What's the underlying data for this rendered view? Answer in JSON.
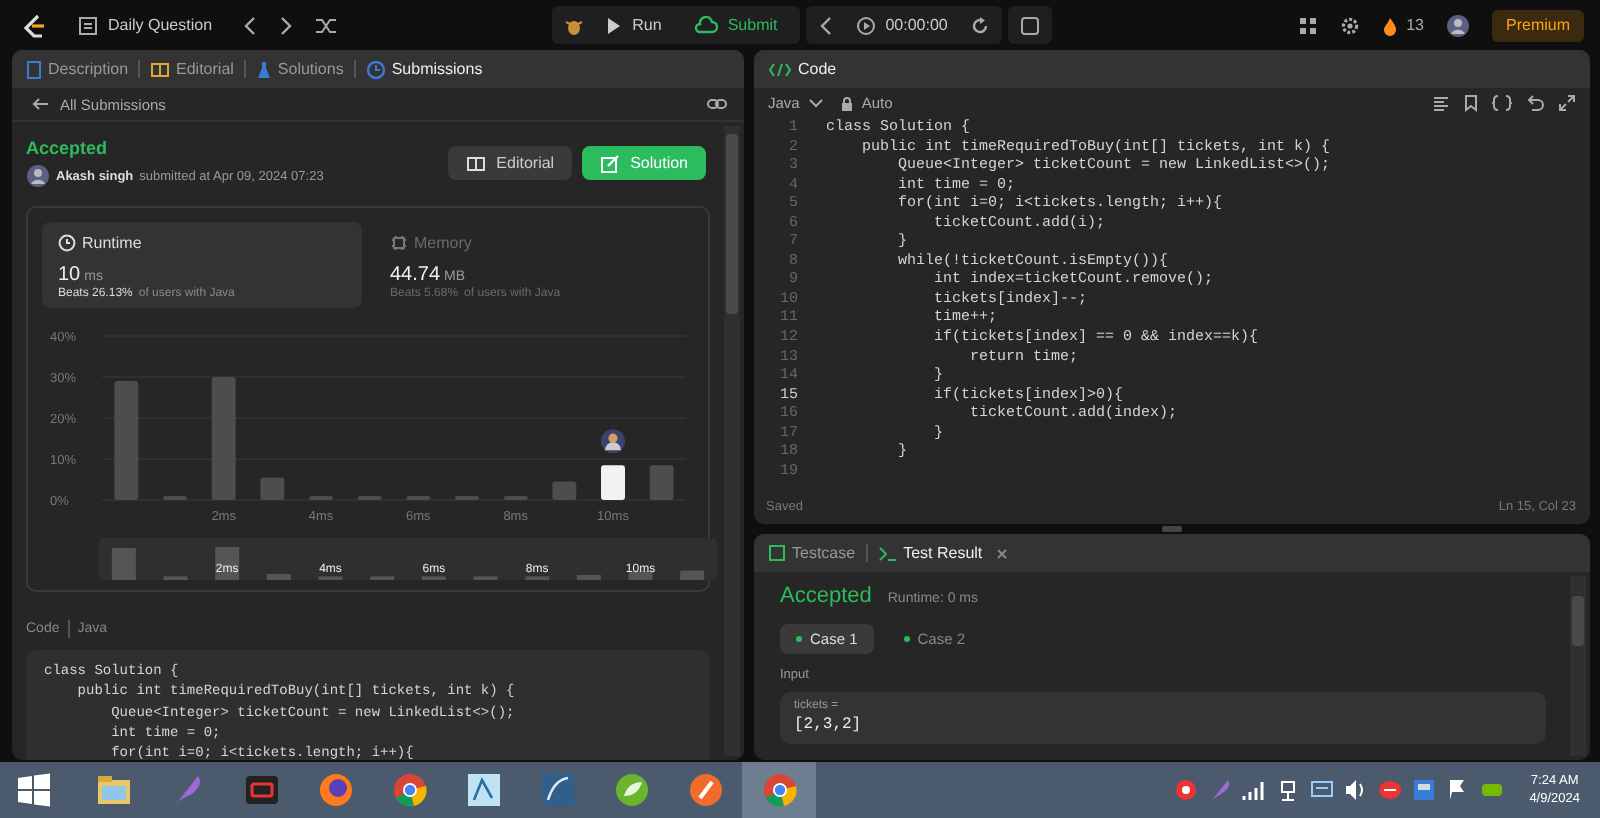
{
  "top_bar": {
    "title": "Daily Question",
    "run": "Run",
    "submit": "Submit",
    "timer": "00:00:00",
    "streak": "13",
    "premium": "Premium"
  },
  "problem_tabs": [
    {
      "label": "Description",
      "kind": "description",
      "selected": false
    },
    {
      "label": "Editorial",
      "kind": "editorial",
      "selected": false
    },
    {
      "label": "Solutions",
      "kind": "solutions",
      "selected": false
    },
    {
      "label": "Submissions",
      "kind": "submissions",
      "selected": true
    }
  ],
  "back_link": "All Submissions",
  "submission": {
    "status": "Accepted",
    "user": "Akash singh",
    "submitted": "submitted at Apr 09, 2024 07:23",
    "buttons": [
      {
        "label": "Editorial",
        "kind": "editorial"
      },
      {
        "label": "Solution",
        "kind": "solution"
      }
    ]
  },
  "stats": [
    {
      "title": "Runtime",
      "kind": "runtime",
      "value": "10",
      "unit": "ms",
      "beats": "Beats 26.13%",
      "suffix": "of users with Java",
      "selected": true
    },
    {
      "title": "Memory",
      "kind": "memory",
      "value": "44.74",
      "unit": "MB",
      "beats": "Beats 5.68%",
      "suffix": "of users with Java",
      "selected": false
    }
  ],
  "chart_data": {
    "type": "bar",
    "x": [
      0,
      1,
      2,
      3,
      4,
      5,
      6,
      7,
      8,
      9,
      10,
      11
    ],
    "xlim": [
      -0.5,
      11.5
    ],
    "grid": true,
    "stacked": true,
    "series": [
      {
        "color": "#4d4d4d",
        "values": [
          29,
          1,
          30,
          5.5,
          1,
          1,
          1,
          1,
          1,
          4.5,
          null,
          8.5
        ]
      },
      {
        "color": "#f2f2f2",
        "values": [
          null,
          null,
          null,
          null,
          null,
          null,
          null,
          null,
          null,
          null,
          8.5,
          null
        ]
      }
    ],
    "ylim": [
      0,
      40
    ],
    "yticks": [
      {
        "value": 0,
        "label": "0%"
      },
      {
        "value": 10,
        "label": "10%"
      },
      {
        "value": 20,
        "label": "20%"
      },
      {
        "value": 30,
        "label": "30%"
      },
      {
        "value": 40,
        "label": "40%"
      }
    ],
    "xticks": [
      {
        "value": 2,
        "label": "2ms"
      },
      {
        "value": 4,
        "label": "4ms"
      },
      {
        "value": 6,
        "label": "6ms"
      },
      {
        "value": 8,
        "label": "8ms"
      },
      {
        "value": 10,
        "label": "10ms"
      }
    ]
  },
  "overview_labels": [
    "2ms",
    "4ms",
    "6ms",
    "8ms",
    "10ms"
  ],
  "code_section": {
    "label": "Code",
    "language": "Java",
    "lines": [
      "class Solution {",
      "    public int timeRequiredToBuy(int[] tickets, int k) {",
      "        Queue<Integer> ticketCount = new LinkedList<>();",
      "        int time = 0;",
      "        for(int i=0; i<tickets.length; i++){"
    ]
  },
  "editor": {
    "tab": "Code",
    "language": "Java",
    "mode": "Auto",
    "status": "Saved",
    "cursor": "Ln 15, Col 23",
    "lines": [
      {
        "number": "1",
        "code": "class Solution {",
        "selected": false
      },
      {
        "number": "2",
        "code": "    public int timeRequiredToBuy(int[] tickets, int k) {",
        "selected": false
      },
      {
        "number": "3",
        "code": "        Queue<Integer> ticketCount = new LinkedList<>();",
        "selected": false
      },
      {
        "number": "4",
        "code": "        int time = 0;",
        "selected": false
      },
      {
        "number": "5",
        "code": "        for(int i=0; i<tickets.length; i++){",
        "selected": false
      },
      {
        "number": "6",
        "code": "            ticketCount.add(i);",
        "selected": false
      },
      {
        "number": "7",
        "code": "        }",
        "selected": false
      },
      {
        "number": "8",
        "code": "        while(!ticketCount.isEmpty()){",
        "selected": false
      },
      {
        "number": "9",
        "code": "            int index=ticketCount.remove();",
        "selected": false
      },
      {
        "number": "10",
        "code": "            tickets[index]--;",
        "selected": false
      },
      {
        "number": "11",
        "code": "            time++;",
        "selected": false
      },
      {
        "number": "12",
        "code": "            if(tickets[index] == 0 && index==k){",
        "selected": false
      },
      {
        "number": "13",
        "code": "                return time;",
        "selected": false
      },
      {
        "number": "14",
        "code": "            }",
        "selected": false
      },
      {
        "number": "15",
        "code": "            if(tickets[index]>0){",
        "selected": true
      },
      {
        "number": "16",
        "code": "                ticketCount.add(index);",
        "selected": false
      },
      {
        "number": "17",
        "code": "            }",
        "selected": false
      },
      {
        "number": "18",
        "code": "        }",
        "selected": false
      },
      {
        "number": "19",
        "selected": false
      }
    ]
  },
  "test_panel": {
    "tabs": [
      {
        "label": "Testcase",
        "kind": "testcase",
        "selected": false,
        "closable": false
      },
      {
        "label": "Test Result",
        "kind": "result",
        "selected": true,
        "closable": true
      }
    ],
    "status": "Accepted",
    "runtime": "Runtime: 0 ms",
    "cases": [
      {
        "label": "Case 1",
        "selected": true
      },
      {
        "label": "Case 2",
        "selected": false
      }
    ],
    "input_label": "Input",
    "inputs": [
      {
        "name": "tickets =",
        "value": "[2,3,2]"
      }
    ]
  },
  "taskbar": {
    "apps": [
      {
        "kind": "folder",
        "selected": false
      },
      {
        "kind": "feather",
        "selected": false
      },
      {
        "kind": "recorder",
        "selected": false
      },
      {
        "kind": "firefox",
        "selected": false
      },
      {
        "kind": "chrome",
        "selected": false
      },
      {
        "kind": "workbench",
        "selected": false
      },
      {
        "kind": "dolphin",
        "selected": false
      },
      {
        "kind": "leaf",
        "selected": false
      },
      {
        "kind": "brush",
        "selected": false
      },
      {
        "kind": "chrome",
        "selected": true
      }
    ],
    "tray": [
      {
        "kind": "record"
      },
      {
        "kind": "feather"
      },
      {
        "kind": "signal"
      },
      {
        "kind": "network"
      },
      {
        "kind": "display"
      },
      {
        "kind": "volume"
      },
      {
        "kind": "badge"
      },
      {
        "kind": "window"
      },
      {
        "kind": "flag"
      },
      {
        "kind": "gpu"
      }
    ],
    "time": "7:24 AM",
    "date": "4/9/2024"
  }
}
